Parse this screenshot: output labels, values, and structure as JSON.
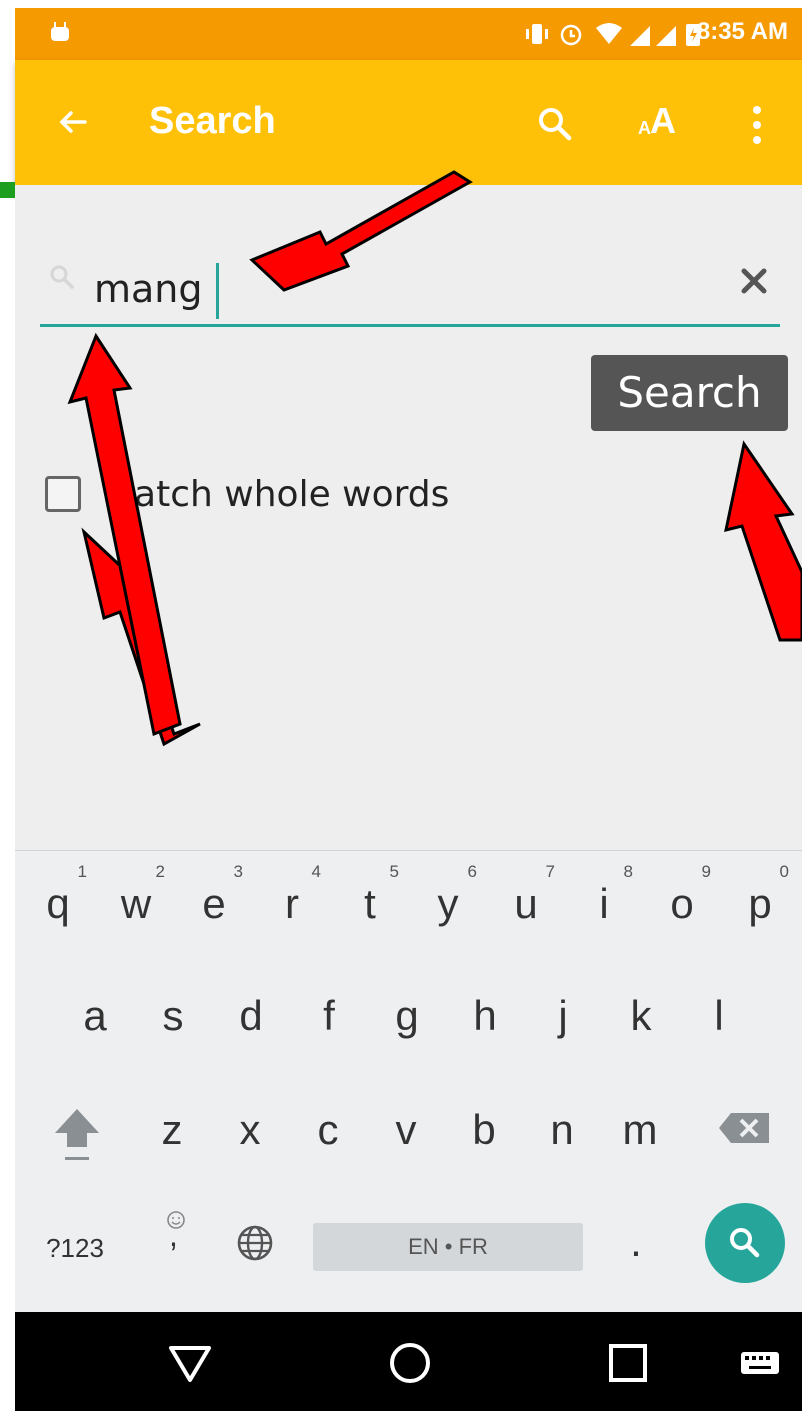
{
  "status_bar": {
    "time": "8:35 AM",
    "icons": [
      "android-debug-icon",
      "vibrate-icon",
      "alarm-icon",
      "wifi-icon",
      "signal-icon",
      "signal-icon",
      "battery-charging-icon"
    ]
  },
  "app_bar": {
    "title": "Search",
    "back_icon": "arrow-left-icon",
    "actions": [
      "search-icon",
      "font-size-icon",
      "more-vert-icon"
    ],
    "font_size_small": "A",
    "font_size_big": "A"
  },
  "search": {
    "value": "mang",
    "placeholder": "",
    "clear_icon": "close-icon",
    "button_label": "Search"
  },
  "options": {
    "match_whole_words": {
      "label": "Match whole words",
      "checked": false
    }
  },
  "keyboard": {
    "row1": [
      {
        "key": "q",
        "num": "1"
      },
      {
        "key": "w",
        "num": "2"
      },
      {
        "key": "e",
        "num": "3"
      },
      {
        "key": "r",
        "num": "4"
      },
      {
        "key": "t",
        "num": "5"
      },
      {
        "key": "y",
        "num": "6"
      },
      {
        "key": "u",
        "num": "7"
      },
      {
        "key": "i",
        "num": "8"
      },
      {
        "key": "o",
        "num": "9"
      },
      {
        "key": "p",
        "num": "0"
      }
    ],
    "row2": [
      "a",
      "s",
      "d",
      "f",
      "g",
      "h",
      "j",
      "k",
      "l"
    ],
    "row3": [
      "z",
      "x",
      "c",
      "v",
      "b",
      "n",
      "m"
    ],
    "symbols_label": "?123",
    "emoji_comma": ",",
    "space_label": "EN • FR",
    "period": "."
  },
  "colors": {
    "status_bar": "#f59a00",
    "app_bar": "#ffc107",
    "accent": "#26a69a",
    "button": "#555555",
    "annotation_arrow": "#ff0000"
  }
}
